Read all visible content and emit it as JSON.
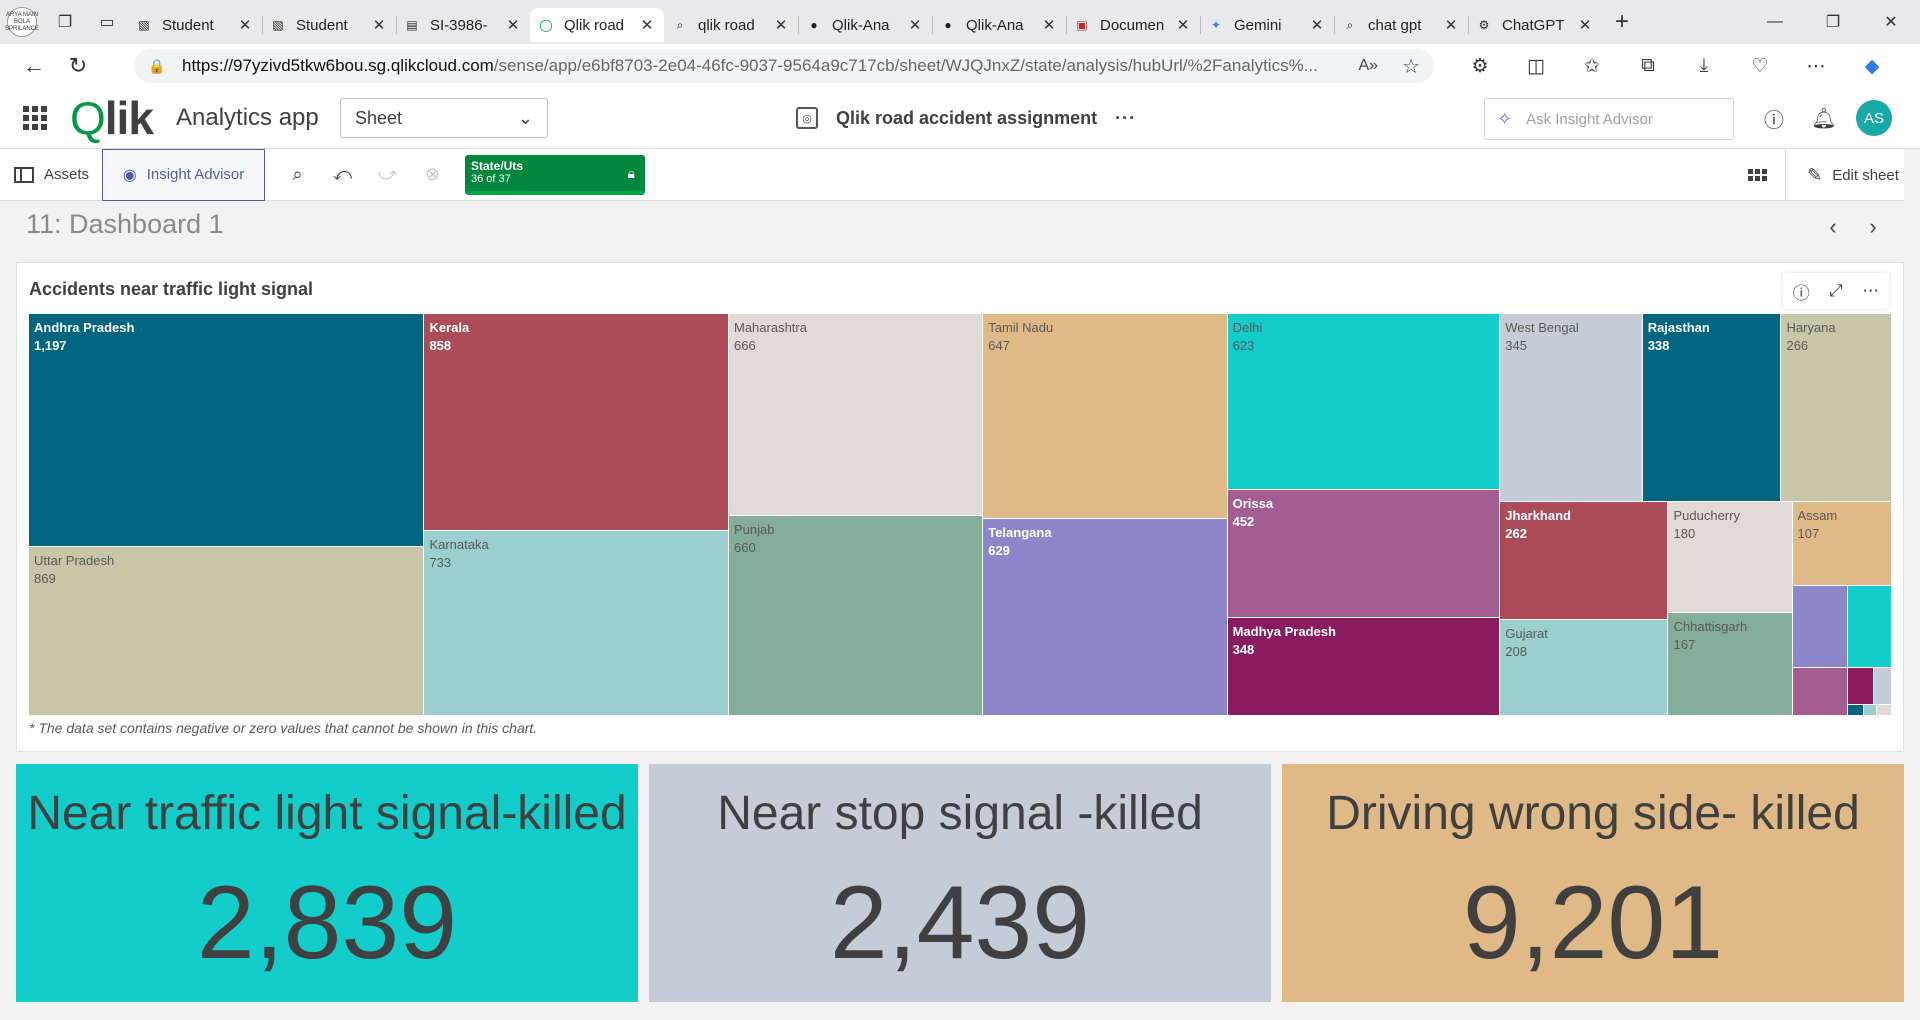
{
  "browser": {
    "workspace_label": "ARYA MAIN BOLA SPRILANCE",
    "tabs": [
      {
        "title": "Student",
        "icon": "image-icon",
        "active": false
      },
      {
        "title": "Student",
        "icon": "image-icon",
        "active": false
      },
      {
        "title": "SI-3986-",
        "icon": "document-icon",
        "active": false
      },
      {
        "title": "Qlik road",
        "icon": "qlik-icon",
        "active": true
      },
      {
        "title": "qlik road",
        "icon": "search-icon",
        "active": false
      },
      {
        "title": "Qlik-Ana",
        "icon": "github-icon",
        "active": false
      },
      {
        "title": "Qlik-Ana",
        "icon": "github-icon",
        "active": false
      },
      {
        "title": "Documen",
        "icon": "pdf-icon",
        "active": false
      },
      {
        "title": "Gemini",
        "icon": "gemini-icon",
        "active": false
      },
      {
        "title": "chat gpt",
        "icon": "search-icon",
        "active": false
      },
      {
        "title": "ChatGPT",
        "icon": "chatgpt-icon",
        "active": false
      }
    ],
    "url_host": "https://97yzivd5tkw6bou.sg.qlikcloud.com",
    "url_path": "/sense/app/e6bf8703-2e04-46fc-9037-9564a9c717cb/sheet/WJQJnxZ/state/analysis/hubUrl/%2Fanalytics%..."
  },
  "header": {
    "logo": "Qlik",
    "app_name": "Analytics app",
    "sheet_selector": "Sheet",
    "sheet_title": "Qlik road accident assignment",
    "ask_placeholder": "Ask Insight Advisor",
    "avatar_initials": "AS"
  },
  "toolbar": {
    "assets_label": "Assets",
    "insight_label": "Insight Advisor",
    "selection_field": "State/Uts",
    "selection_count": "36 of 37",
    "edit_label": "Edit sheet"
  },
  "sheet": {
    "name": "11: Dashboard 1"
  },
  "treemap": {
    "title": "Accidents near traffic light signal",
    "note": "* The data set contains negative or zero values that cannot be shown in this chart.",
    "colors": {
      "Andhra Pradesh": "#006580",
      "Uttar Pradesh": "#c8c6a8",
      "Kerala": "#ad4c58",
      "Karnataka": "#9acfcd",
      "Maharashtra": "#e2dad6",
      "Punjab": "#85ae99",
      "Tamil Nadu": "#dfba86",
      "Telangana": "#8c85c8",
      "Delhi": "#12cdc9",
      "Orissa": "#a35d91",
      "Madhya Pradesh": "#8a1c5d",
      "West Bengal": "#c4ccd7",
      "Jharkhand": "#ad4c58",
      "Gujarat": "#9acfcd",
      "Rajasthan": "#006580",
      "Puducherry": "#e2dad6",
      "Chhattisgarh": "#85ae99",
      "Haryana": "#c8c6a8",
      "Assam": "#dfba86",
      "small_1": "#8c85c8",
      "small_2": "#12cdc9",
      "small_3": "#a35d91",
      "small_4": "#8a1c5d",
      "small_5": "#c4ccd7",
      "small_6": "#006580",
      "small_7": "#9acfcd",
      "small_8": "#e2dad6"
    },
    "items": [
      {
        "name": "Andhra Pradesh",
        "value": "1,197",
        "tone": "dark"
      },
      {
        "name": "Uttar Pradesh",
        "value": "869",
        "tone": "light"
      },
      {
        "name": "Kerala",
        "value": "858",
        "tone": "dark"
      },
      {
        "name": "Karnataka",
        "value": "733",
        "tone": "light"
      },
      {
        "name": "Maharashtra",
        "value": "666",
        "tone": "light"
      },
      {
        "name": "Punjab",
        "value": "660",
        "tone": "light"
      },
      {
        "name": "Tamil Nadu",
        "value": "647",
        "tone": "light"
      },
      {
        "name": "Telangana",
        "value": "629",
        "tone": "dark"
      },
      {
        "name": "Delhi",
        "value": "623",
        "tone": "light"
      },
      {
        "name": "Orissa",
        "value": "452",
        "tone": "dark"
      },
      {
        "name": "Madhya Pradesh",
        "value": "348",
        "tone": "dark"
      },
      {
        "name": "West Bengal",
        "value": "345",
        "tone": "light"
      },
      {
        "name": "Jharkhand",
        "value": "262",
        "tone": "dark"
      },
      {
        "name": "Gujarat",
        "value": "208",
        "tone": "light"
      },
      {
        "name": "Rajasthan",
        "value": "338",
        "tone": "dark"
      },
      {
        "name": "Puducherry",
        "value": "180",
        "tone": "light"
      },
      {
        "name": "Chhattisgarh",
        "value": "167",
        "tone": "light"
      },
      {
        "name": "Haryana",
        "value": "266",
        "tone": "light"
      },
      {
        "name": "Assam",
        "value": "107",
        "tone": "light"
      }
    ]
  },
  "kpis": [
    {
      "title": "Near traffic light signal-killed",
      "value": "2,839",
      "color": "#12cdc9"
    },
    {
      "title": "Near stop signal -killed",
      "value": "2,439",
      "color": "#c4ccd7"
    },
    {
      "title": "Driving wrong side- killed",
      "value": "9,201",
      "color": "#dfba86"
    }
  ]
}
